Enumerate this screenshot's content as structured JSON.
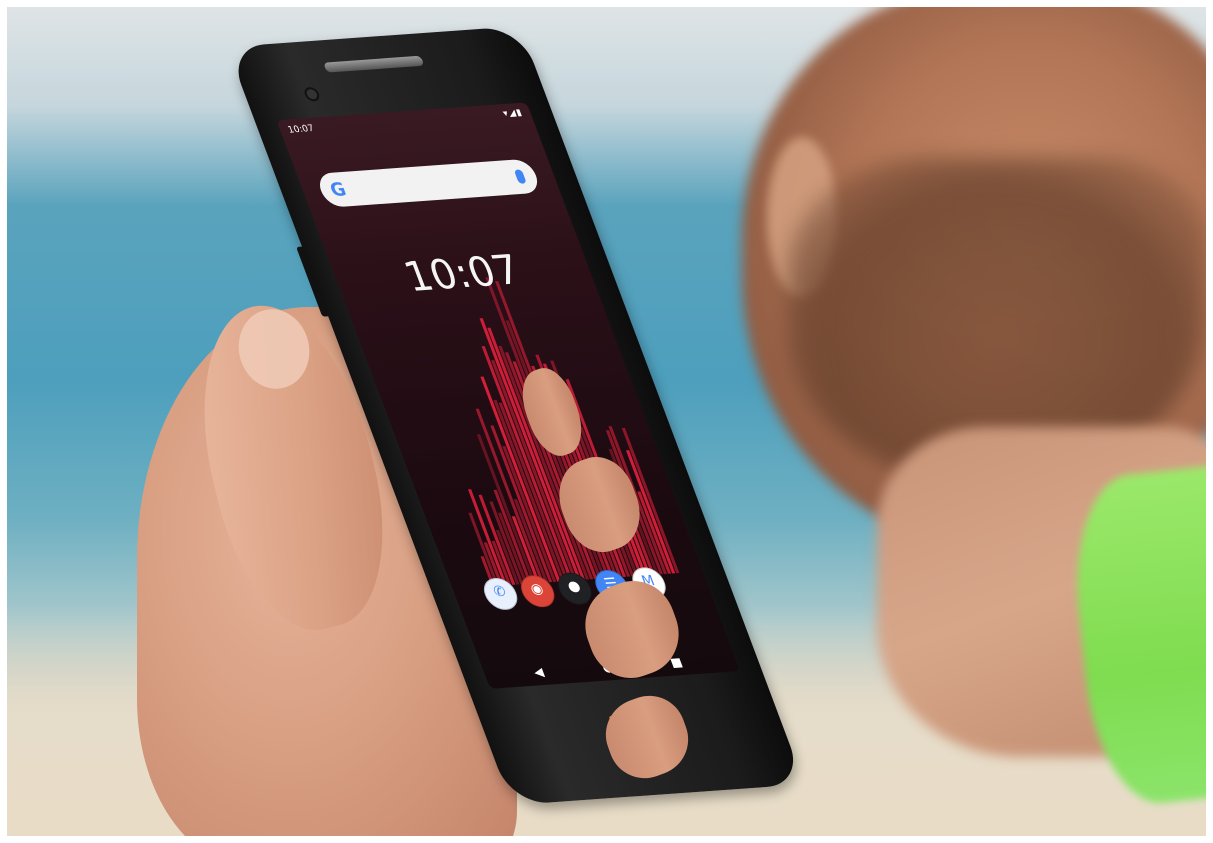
{
  "photo": {
    "subject": "man-holding-rugged-smartphone",
    "colors": {
      "sea": "#4d9fbd",
      "sand": "#e6dcc9",
      "shirt": "#7fdc4f",
      "skin": "#d79d80",
      "phone": "#1b1b1b",
      "wallpaper_red": "#e0203c"
    }
  },
  "phone": {
    "status_time": "10:07",
    "status_icons": "▾◢▮",
    "clock": "10:07",
    "search_logo": "G",
    "dock_apps": [
      {
        "name": "phone-app-icon",
        "glyph": "✆",
        "color": "#e8f0fe"
      },
      {
        "name": "chrome-app-icon",
        "glyph": "◉",
        "color": "#db4437"
      },
      {
        "name": "camera-app-icon",
        "glyph": "●",
        "color": "#202124"
      },
      {
        "name": "messages-app-icon",
        "glyph": "☰",
        "color": "#4285f4"
      },
      {
        "name": "gmail-app-icon",
        "glyph": "M",
        "color": "#ffffff"
      }
    ],
    "nav": {
      "back": "◀",
      "home": "●",
      "recent": "■"
    }
  }
}
